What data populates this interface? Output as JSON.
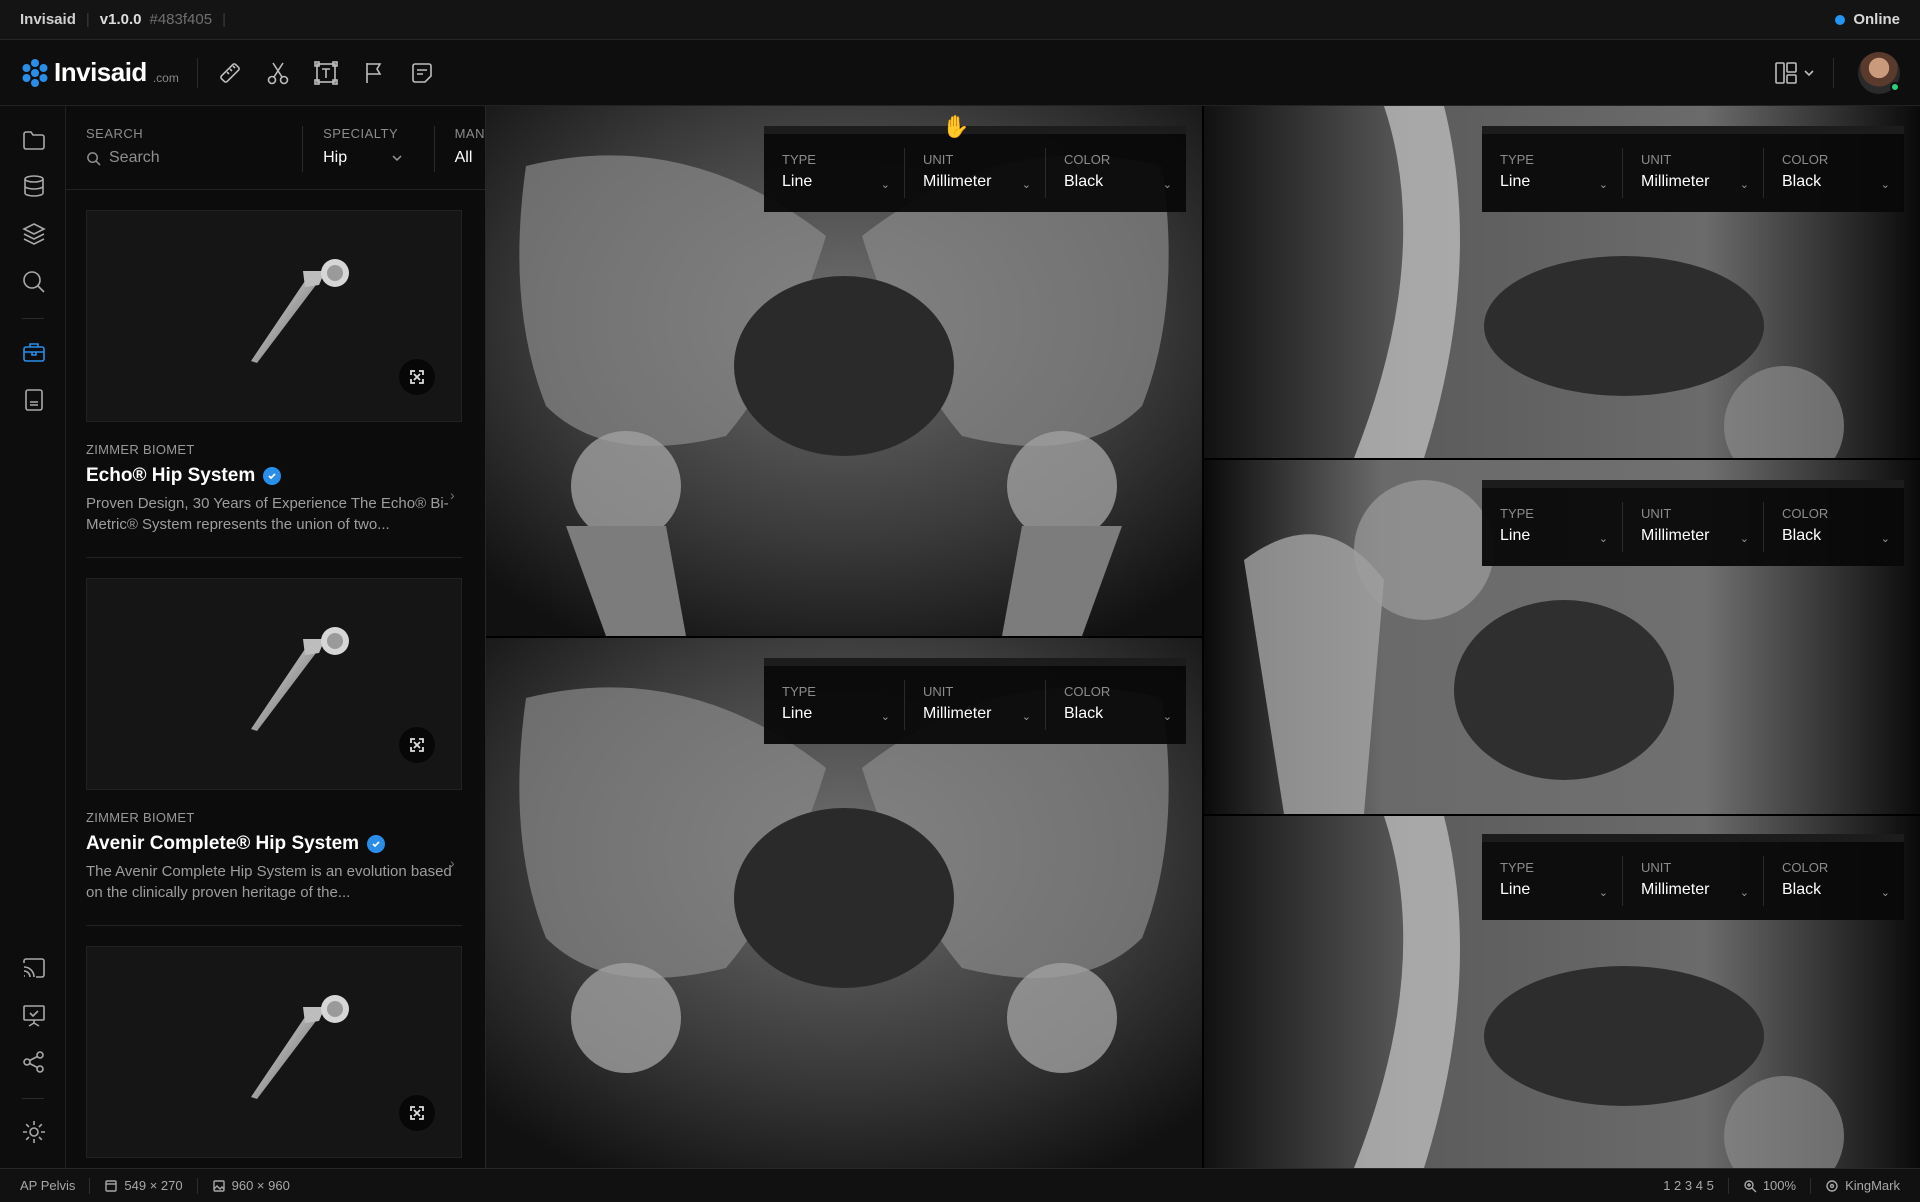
{
  "titlebar": {
    "app": "Invisaid",
    "version": "v1.0.0",
    "hash": "#483f405",
    "status": "Online"
  },
  "logo": {
    "word": "Invisaid",
    "suffix": ".com"
  },
  "filters": {
    "search_label": "SEARCH",
    "search_placeholder": "Search",
    "specialty_label": "SPECIALTY",
    "specialty_value": "Hip",
    "manufacturer_label": "MAN",
    "manufacturer_value": "All"
  },
  "implants": [
    {
      "maker": "ZIMMER BIOMET",
      "title": "Echo® Hip System",
      "desc": "Proven Design, 30 Years of Experience The Echo® Bi-Metric® System represents the union of two..."
    },
    {
      "maker": "ZIMMER BIOMET",
      "title": "Avenir Complete® Hip System",
      "desc": "The Avenir Complete Hip System is an evolution based on the clinically proven heritage of the..."
    }
  ],
  "measure_tool": {
    "type_label": "TYPE",
    "type_value": "Line",
    "unit_label": "UNIT",
    "unit_value": "Millimeter",
    "color_label": "COLOR",
    "color_value": "Black"
  },
  "statusbar": {
    "view": "AP Pelvis",
    "selection": "549 × 270",
    "image": "960 × 960",
    "pages": "1 2 3 4 5",
    "zoom": "100%",
    "brand": "KingMark"
  }
}
